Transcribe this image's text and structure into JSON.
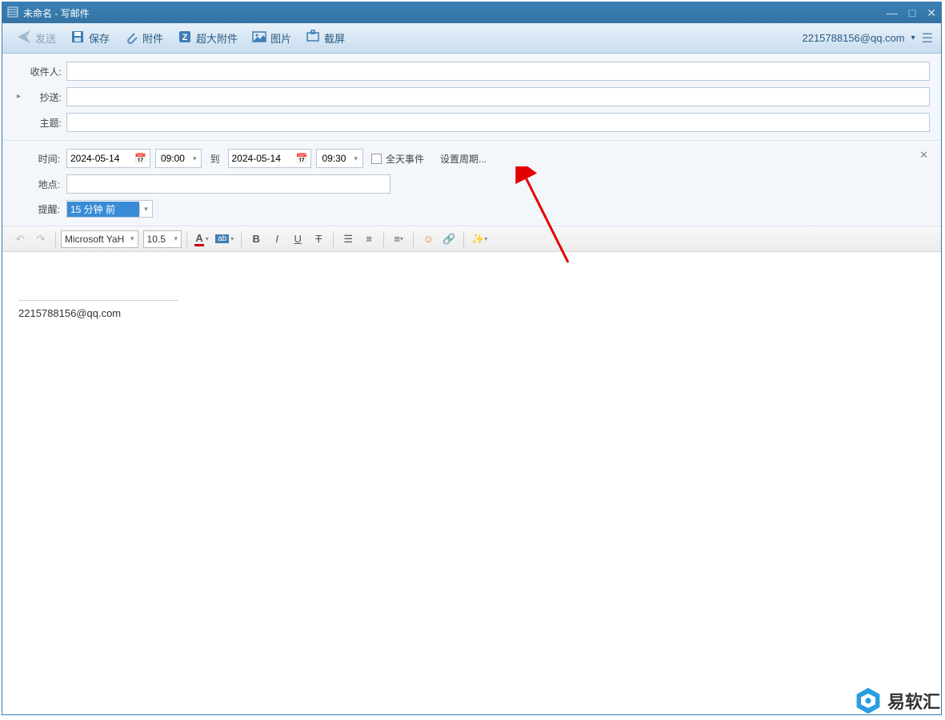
{
  "window": {
    "title": "未命名 - 写邮件"
  },
  "toolbar": {
    "send": "发送",
    "save": "保存",
    "attach": "附件",
    "bigattach": "超大附件",
    "image": "图片",
    "screenshot": "截屏"
  },
  "account": {
    "email": "2215788156@qq.com"
  },
  "fields": {
    "to_label": "收件人:",
    "cc_label": "抄送:",
    "subject_label": "主题:"
  },
  "event": {
    "time_label": "时间:",
    "start_date": "2024-05-14",
    "start_time": "09:00",
    "to_word": "到",
    "end_date": "2024-05-14",
    "end_time": "09:30",
    "allday_label": "全天事件",
    "recurrence_label": "设置周期...",
    "location_label": "地点:",
    "reminder_label": "提醒:",
    "reminder_value": "15 分钟 前"
  },
  "editor": {
    "font_name": "Microsoft YaH",
    "font_size": "10.5"
  },
  "body": {
    "signature": "2215788156@qq.com"
  },
  "watermark": "易软汇"
}
